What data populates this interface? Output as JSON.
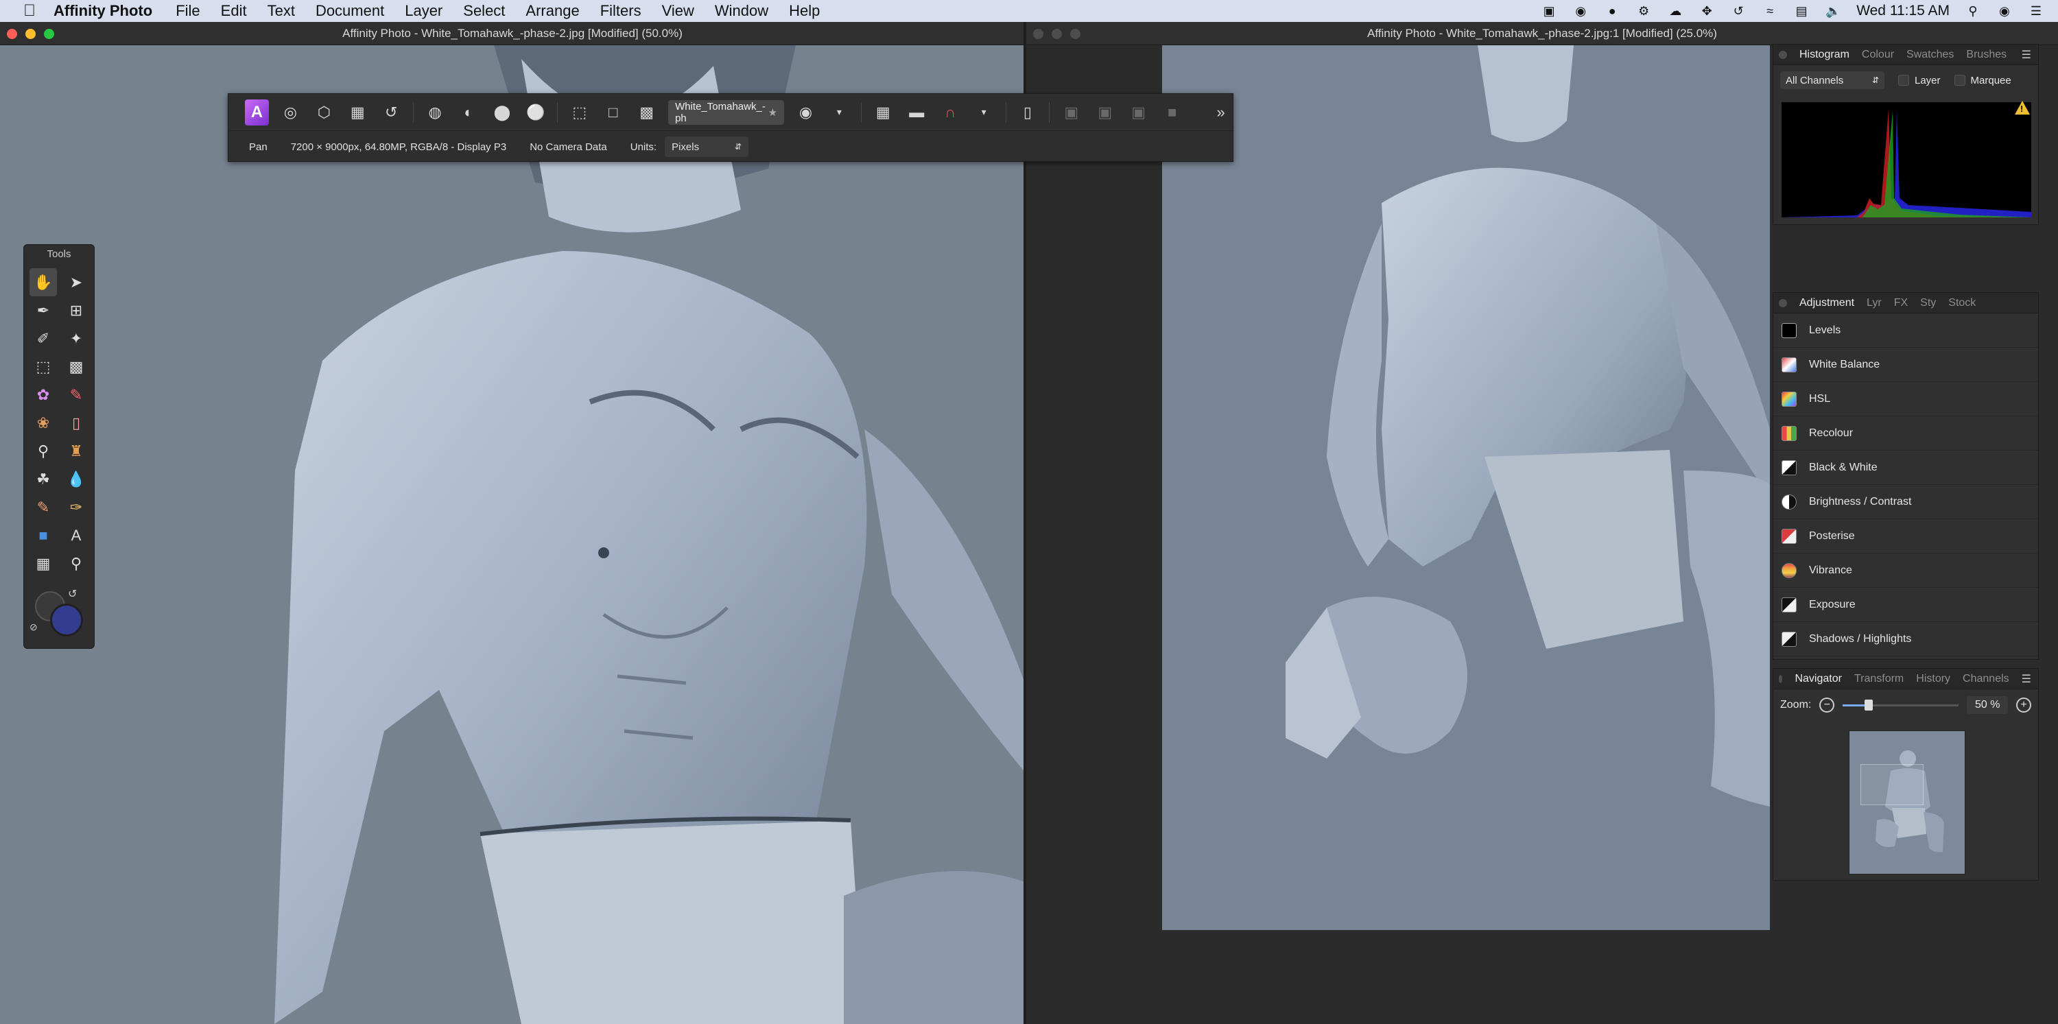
{
  "menubar": {
    "app_name": "Affinity Photo",
    "items": [
      "File",
      "Edit",
      "Text",
      "Document",
      "Layer",
      "Select",
      "Arrange",
      "Filters",
      "View",
      "Window",
      "Help"
    ],
    "clock": "Wed 11:15 AM"
  },
  "windows": {
    "left_title": "Affinity Photo - White_Tomahawk_-phase-2.jpg [Modified] (50.0%)",
    "right_title": "Affinity Photo - White_Tomahawk_-phase-2.jpg:1 [Modified] (25.0%)"
  },
  "context_toolbar": {
    "document_chip": "White_Tomahawk_-ph",
    "tool_name": "Pan",
    "image_info": "7200 × 9000px, 64.80MP, RGBA/8 - Display P3",
    "camera": "No Camera Data",
    "units_label": "Units:",
    "units_value": "Pixels"
  },
  "tools_panel": {
    "title": "Tools"
  },
  "histogram": {
    "tabs": [
      "Histogram",
      "Colour",
      "Swatches",
      "Brushes"
    ],
    "channel": "All Channels",
    "layer_label": "Layer",
    "marquee_label": "Marquee"
  },
  "adjustment": {
    "tabs": [
      "Adjustment",
      "Lyr",
      "FX",
      "Sty",
      "Stock"
    ],
    "items": [
      "Levels",
      "White Balance",
      "HSL",
      "Recolour",
      "Black & White",
      "Brightness / Contrast",
      "Posterise",
      "Vibrance",
      "Exposure",
      "Shadows / Highlights"
    ]
  },
  "navigator": {
    "tabs": [
      "Navigator",
      "Transform",
      "History",
      "Channels"
    ],
    "zoom_label": "Zoom:",
    "zoom_value": "50 %",
    "zoom_fraction": 0.22
  }
}
